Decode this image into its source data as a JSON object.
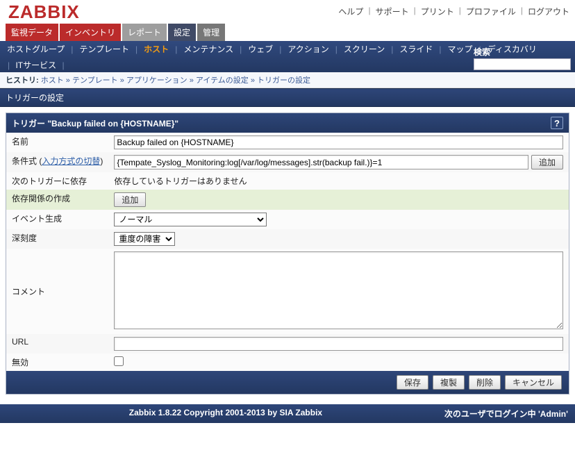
{
  "logo": "ZABBIX",
  "toplinks": {
    "help": "ヘルプ",
    "support": "サポート",
    "print": "プリント",
    "profile": "プロファイル",
    "logout": "ログアウト"
  },
  "tabs1": {
    "monitor": "監視データ",
    "inventory": "インベントリ",
    "reports": "レポート",
    "settings": "設定",
    "admin": "管理"
  },
  "nav": {
    "hostgroups": "ホストグループ",
    "templates": "テンプレート",
    "hosts": "ホスト",
    "maintenance": "メンテナンス",
    "web": "ウェブ",
    "actions": "アクション",
    "screens": "スクリーン",
    "slides": "スライド",
    "maps": "マップ",
    "discovery": "ディスカバリ",
    "itservice": "ITサービス",
    "search_label": "検索"
  },
  "history": {
    "label": "ヒストリ:",
    "items": [
      "ホスト",
      "テンプレート",
      "アプリケーション",
      "アイテムの設定",
      "トリガーの設定"
    ]
  },
  "section_title": "トリガーの設定",
  "panel_title_prefix": "トリガー",
  "panel_title_quoted": "\"Backup failed on {HOSTNAME}\"",
  "form": {
    "name_label": "名前",
    "name_value": "Backup failed on {HOSTNAME}",
    "expr_label": "条件式",
    "expr_toggle": "入力方式の切替",
    "expr_value": "{Tempate_Syslog_Monitoring:log[/var/log/messages].str(backup fail.)}=1",
    "expr_add_btn": "追加",
    "dep_label": "次のトリガーに依存",
    "dep_text": "依存しているトリガーはありません",
    "dep_create_label": "依存関係の作成",
    "dep_add_btn": "追加",
    "event_label": "イベント生成",
    "event_value": "ノーマル",
    "severity_label": "深刻度",
    "severity_value": "重度の障害",
    "comment_label": "コメント",
    "comment_value": "",
    "url_label": "URL",
    "url_value": "",
    "disabled_label": "無効"
  },
  "buttons": {
    "save": "保存",
    "clone": "複製",
    "delete": "削除",
    "cancel": "キャンセル"
  },
  "footer": {
    "copyright": "Zabbix 1.8.22 Copyright 2001-2013 by SIA Zabbix",
    "login": "次のユーザでログイン中 'Admin'"
  }
}
